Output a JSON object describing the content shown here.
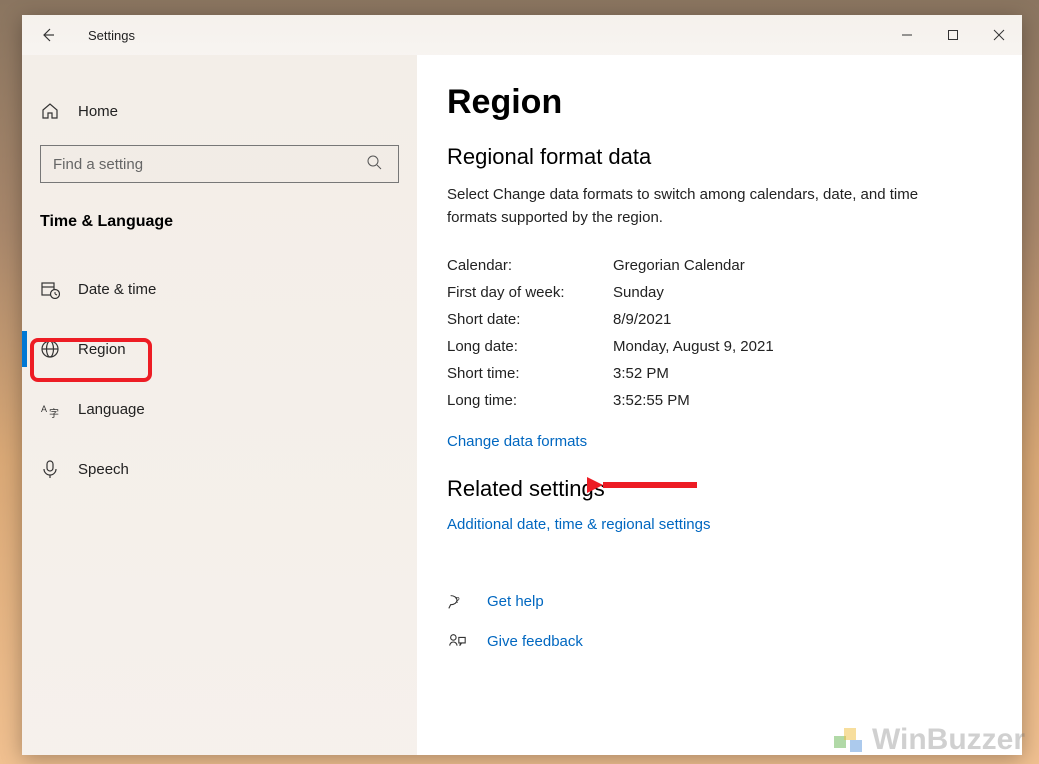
{
  "titlebar": {
    "app_name": "Settings"
  },
  "sidebar": {
    "home_label": "Home",
    "search_placeholder": "Find a setting",
    "category": "Time & Language",
    "items": [
      {
        "label": "Date & time"
      },
      {
        "label": "Region"
      },
      {
        "label": "Language"
      },
      {
        "label": "Speech"
      }
    ]
  },
  "main": {
    "title": "Region",
    "section_title": "Regional format data",
    "section_desc": "Select Change data formats to switch among calendars, date, and time formats supported by the region.",
    "rows": [
      {
        "key": "Calendar:",
        "value": "Gregorian Calendar"
      },
      {
        "key": "First day of week:",
        "value": "Sunday"
      },
      {
        "key": "Short date:",
        "value": "8/9/2021"
      },
      {
        "key": "Long date:",
        "value": "Monday, August 9, 2021"
      },
      {
        "key": "Short time:",
        "value": "3:52 PM"
      },
      {
        "key": "Long time:",
        "value": "3:52:55 PM"
      }
    ],
    "change_formats_link": "Change data formats",
    "related_title": "Related settings",
    "related_link": "Additional date, time & regional settings",
    "help_link": "Get help",
    "feedback_link": "Give feedback"
  },
  "watermark": "WinBuzzer"
}
